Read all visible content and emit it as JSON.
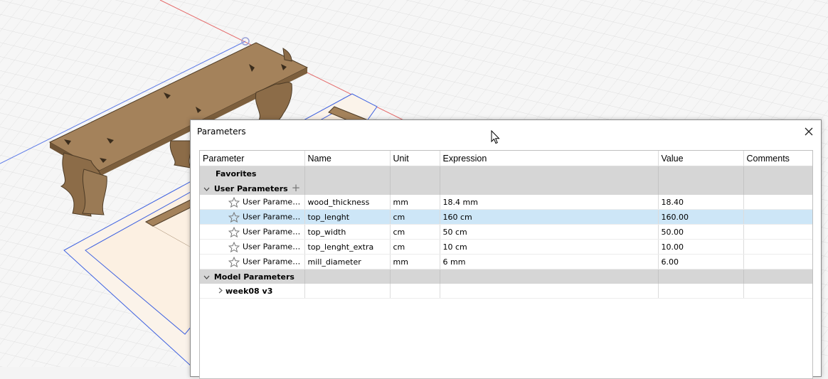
{
  "dialog": {
    "title": "Parameters"
  },
  "columns": [
    "Parameter",
    "Name",
    "Unit",
    "Expression",
    "Value",
    "Comments"
  ],
  "groups": {
    "favorites": "Favorites",
    "user": "User Parameters",
    "model": "Model Parameters"
  },
  "user_params": [
    {
      "param": "User Paramet...",
      "name": "wood_thickness",
      "unit": "mm",
      "expression": "18.4 mm",
      "value": "18.40",
      "comments": ""
    },
    {
      "param": "User Paramet...",
      "name": "top_lenght",
      "unit": "cm",
      "expression": "160 cm",
      "value": "160.00",
      "comments": ""
    },
    {
      "param": "User Paramet...",
      "name": "top_width",
      "unit": "cm",
      "expression": "50 cm",
      "value": "50.00",
      "comments": ""
    },
    {
      "param": "User Paramet...",
      "name": "top_lenght_extra",
      "unit": "cm",
      "expression": "10 cm",
      "value": "10.00",
      "comments": ""
    },
    {
      "param": "User Paramet...",
      "name": "mill_diameter",
      "unit": "mm",
      "expression": "6 mm",
      "value": "6.00",
      "comments": ""
    }
  ],
  "model_items": [
    {
      "label": "week08 v3"
    }
  ],
  "selected_row": "top_lenght",
  "colors": {
    "selection": "#cde6f7",
    "group_header": "#d6d6d6",
    "wood": "#9b7a54",
    "axis_red": "#e05a5a",
    "axis_blue": "#4a6ee0"
  },
  "icons": [
    "close-icon",
    "star-icon",
    "chevron-down-icon",
    "chevron-right-icon",
    "add-icon",
    "mouse-cursor-icon"
  ]
}
